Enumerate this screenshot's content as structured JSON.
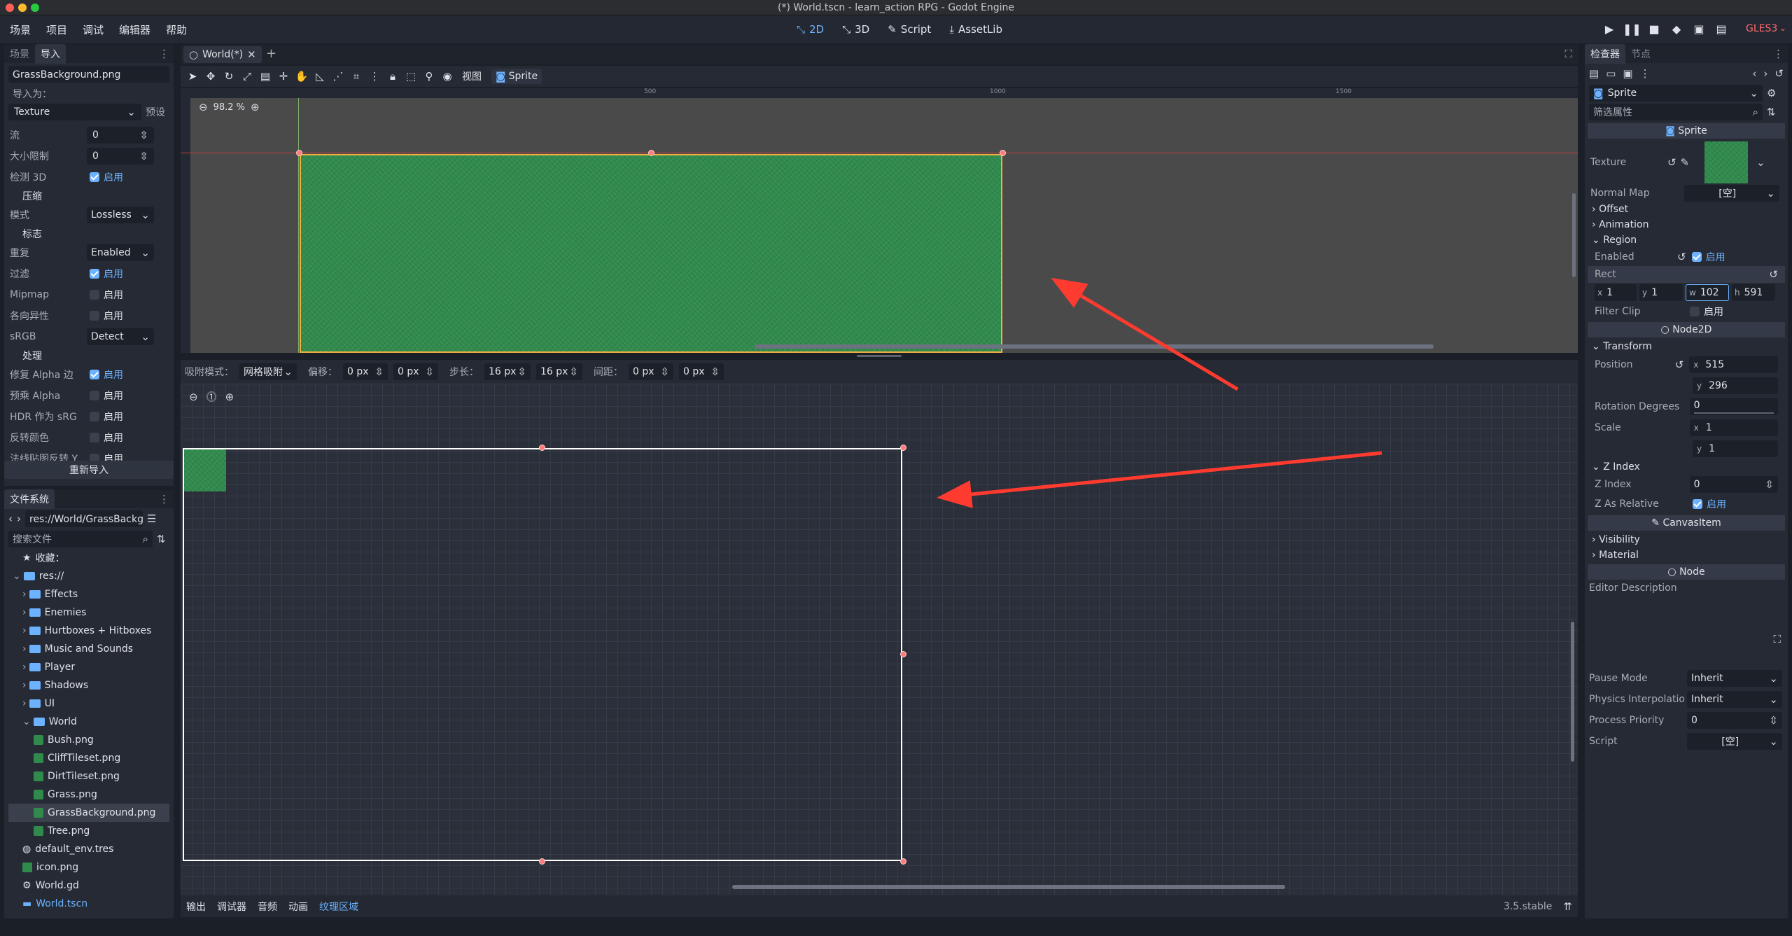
{
  "window": {
    "title": "(*) World.tscn - learn_action RPG - Godot Engine"
  },
  "menu": [
    "场景",
    "项目",
    "调试",
    "编辑器",
    "帮助"
  ],
  "workspaces": [
    "2D",
    "3D",
    "Script",
    "AssetLib"
  ],
  "renderer": "GLES3",
  "left_dock": {
    "tabs": [
      "场景",
      "导入"
    ],
    "file_name": "GrassBackground.png",
    "import_as_label": "导入为：",
    "import_type": "Texture",
    "preset_label": "预设",
    "props": [
      {
        "label": "流",
        "value": "0",
        "kind": "spin"
      },
      {
        "label": "大小限制",
        "value": "0",
        "kind": "spin"
      },
      {
        "label": "检测 3D",
        "value": "启用",
        "kind": "check",
        "on": true
      },
      {
        "label": "压缩",
        "kind": "section"
      },
      {
        "label": "模式",
        "value": "Lossless",
        "kind": "select"
      },
      {
        "label": "标志",
        "kind": "section"
      },
      {
        "label": "重复",
        "value": "Enabled",
        "kind": "select"
      },
      {
        "label": "过滤",
        "value": "启用",
        "kind": "check",
        "on": true
      },
      {
        "label": "Mipmap",
        "value": "启用",
        "kind": "check",
        "on": false
      },
      {
        "label": "各向异性",
        "value": "启用",
        "kind": "check",
        "on": false
      },
      {
        "label": "sRGB",
        "value": "Detect",
        "kind": "select"
      },
      {
        "label": "处理",
        "kind": "section"
      },
      {
        "label": "修复 Alpha 边",
        "value": "启用",
        "kind": "check",
        "on": true
      },
      {
        "label": "预乘 Alpha",
        "value": "启用",
        "kind": "check",
        "on": false
      },
      {
        "label": "HDR 作为 sRG",
        "value": "启用",
        "kind": "check",
        "on": false
      },
      {
        "label": "反转颜色",
        "value": "启用",
        "kind": "check",
        "on": false
      },
      {
        "label": "法线贴图反转 Y",
        "value": "启用",
        "kind": "check",
        "on": false
      }
    ],
    "reimport": "重新导入"
  },
  "filesystem": {
    "title": "文件系统",
    "path": "res://World/GrassBackgr",
    "search_placeholder": "搜索文件",
    "favorites": "收藏：",
    "root": "res://",
    "items": [
      {
        "name": "Effects",
        "type": "folder",
        "depth": 1
      },
      {
        "name": "Enemies",
        "type": "folder",
        "depth": 1
      },
      {
        "name": "Hurtboxes + Hitboxes",
        "type": "folder",
        "depth": 1
      },
      {
        "name": "Music and Sounds",
        "type": "folder",
        "depth": 1
      },
      {
        "name": "Player",
        "type": "folder",
        "depth": 1
      },
      {
        "name": "Shadows",
        "type": "folder",
        "depth": 1
      },
      {
        "name": "UI",
        "type": "folder",
        "depth": 1
      },
      {
        "name": "World",
        "type": "folder-open",
        "depth": 1
      },
      {
        "name": "Bush.png",
        "type": "image",
        "depth": 2
      },
      {
        "name": "CliffTileset.png",
        "type": "image",
        "depth": 2
      },
      {
        "name": "DirtTileset.png",
        "type": "image",
        "depth": 2
      },
      {
        "name": "Grass.png",
        "type": "image",
        "depth": 2
      },
      {
        "name": "GrassBackground.png",
        "type": "image",
        "depth": 2,
        "selected": true
      },
      {
        "name": "Tree.png",
        "type": "image",
        "depth": 2
      },
      {
        "name": "default_env.tres",
        "type": "resource",
        "depth": 1
      },
      {
        "name": "icon.png",
        "type": "image",
        "depth": 1
      },
      {
        "name": "World.gd",
        "type": "script",
        "depth": 1
      },
      {
        "name": "World.tscn",
        "type": "scene",
        "depth": 1
      }
    ]
  },
  "editor": {
    "scene_tab": "World(*)",
    "view_label": "视图",
    "sprite_label": "Sprite",
    "zoom": "98.2 %",
    "ruler_marks": [
      "500",
      "1000",
      "1500"
    ]
  },
  "region_editor": {
    "snap_label": "吸附模式：",
    "snap_mode": "网格吸附",
    "offset_label": "偏移：",
    "offset_x": "0 px",
    "offset_y": "0 px",
    "step_label": "步长：",
    "step_x": "16 px",
    "step_y": "16 px",
    "sep_label": "间距：",
    "sep_x": "0 px",
    "sep_y": "0 px"
  },
  "bottom_tabs": [
    "输出",
    "调试器",
    "音频",
    "动画",
    "纹理区域"
  ],
  "bottom_active": "纹理区域",
  "version": "3.5.stable",
  "inspector": {
    "tabs": [
      "检查器",
      "节点"
    ],
    "node_type": "Sprite",
    "filter_placeholder": "筛选属性",
    "sprite_header": "Sprite",
    "texture_label": "Texture",
    "normal_map_label": "Normal Map",
    "normal_map_value": "[空]",
    "offset": "Offset",
    "animation": "Animation",
    "region": "Region",
    "enabled_label": "Enabled",
    "enabled_value": "启用",
    "rect_label": "Rect",
    "rect": {
      "x": "1",
      "y": "1",
      "w": "102",
      "h": "591"
    },
    "filter_clip_label": "Filter Clip",
    "filter_clip_value": "启用",
    "node2d_header": "Node2D",
    "transform": "Transform",
    "position_label": "Position",
    "pos_x": "515",
    "pos_y": "296",
    "rotation_label": "Rotation Degrees",
    "rotation_value": "0",
    "scale_label": "Scale",
    "scale_x": "1",
    "scale_y": "1",
    "z_index_section": "Z Index",
    "z_index_label": "Z Index",
    "z_index_value": "0",
    "z_relative_label": "Z As Relative",
    "z_relative_value": "启用",
    "canvas_header": "CanvasItem",
    "visibility": "Visibility",
    "material": "Material",
    "node_header": "Node",
    "editor_desc": "Editor Description",
    "pause_mode_label": "Pause Mode",
    "pause_mode_value": "Inherit",
    "physics_label": "Physics Interpolatio",
    "physics_value": "Inherit",
    "priority_label": "Process Priority",
    "priority_value": "0",
    "script_label": "Script",
    "script_value": "[空]"
  },
  "colors": {
    "accent": "#6db2ff",
    "grass": "#2f8a4c",
    "arrow": "#ff3b30",
    "handle": "#ff7b7b"
  }
}
